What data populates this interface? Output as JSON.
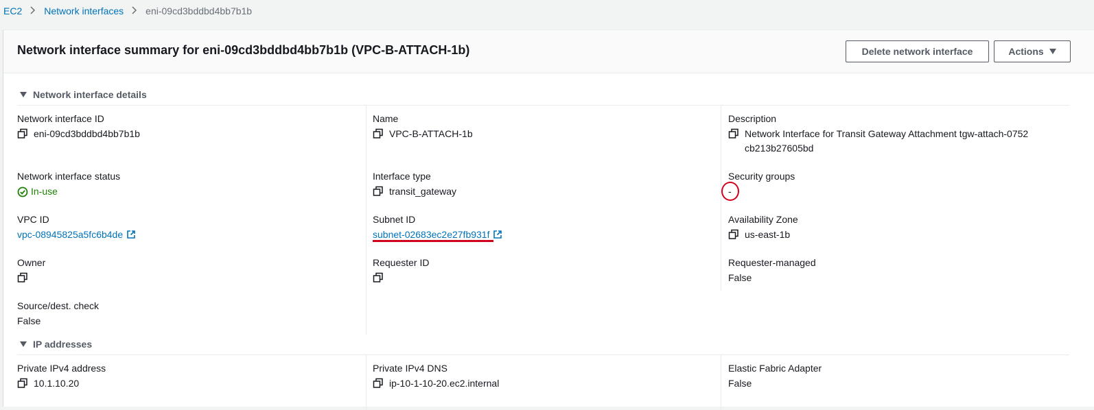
{
  "breadcrumb": {
    "items": [
      "EC2",
      "Network interfaces"
    ],
    "current": "eni-09cd3bddbd4bb7b1b"
  },
  "header": {
    "title": "Network interface summary for eni-09cd3bddbd4bb7b1b (VPC-B-ATTACH-1b)",
    "delete_label": "Delete network interface",
    "actions_label": "Actions"
  },
  "details": {
    "section_title": "Network interface details",
    "eni_id_label": "Network interface ID",
    "eni_id": "eni-09cd3bddbd4bb7b1b",
    "name_label": "Name",
    "name": "VPC-B-ATTACH-1b",
    "description_label": "Description",
    "description": "Network Interface for Transit Gateway Attachment tgw-attach-0752cb213b27605bd",
    "status_label": "Network interface status",
    "status": "In-use",
    "type_label": "Interface type",
    "type": "transit_gateway",
    "sg_label": "Security groups",
    "sg_value": "-",
    "vpc_label": "VPC ID",
    "vpc_id": "vpc-08945825a5fc6b4de",
    "subnet_label": "Subnet ID",
    "subnet_id": "subnet-02683ec2e27fb931f",
    "az_label": "Availability Zone",
    "az": "us-east-1b",
    "owner_label": "Owner",
    "requester_label": "Requester ID",
    "req_managed_label": "Requester-managed",
    "req_managed": "False",
    "srcdst_label": "Source/dest. check",
    "srcdst": "False"
  },
  "ip": {
    "section_title": "IP addresses",
    "ipv4_label": "Private IPv4 address",
    "ipv4": "10.1.10.20",
    "dns_label": "Private IPv4 DNS",
    "dns": "ip-10-1-10-20.ec2.internal",
    "efa_label": "Elastic Fabric Adapter",
    "efa": "False"
  },
  "colors": {
    "link": "#0073bb",
    "success": "#1d8102",
    "annotation": "#d0021b"
  },
  "icons": [
    "copy-icon",
    "external-link-icon",
    "check-circle-icon",
    "chevron-right-icon",
    "caret-down-icon"
  ]
}
